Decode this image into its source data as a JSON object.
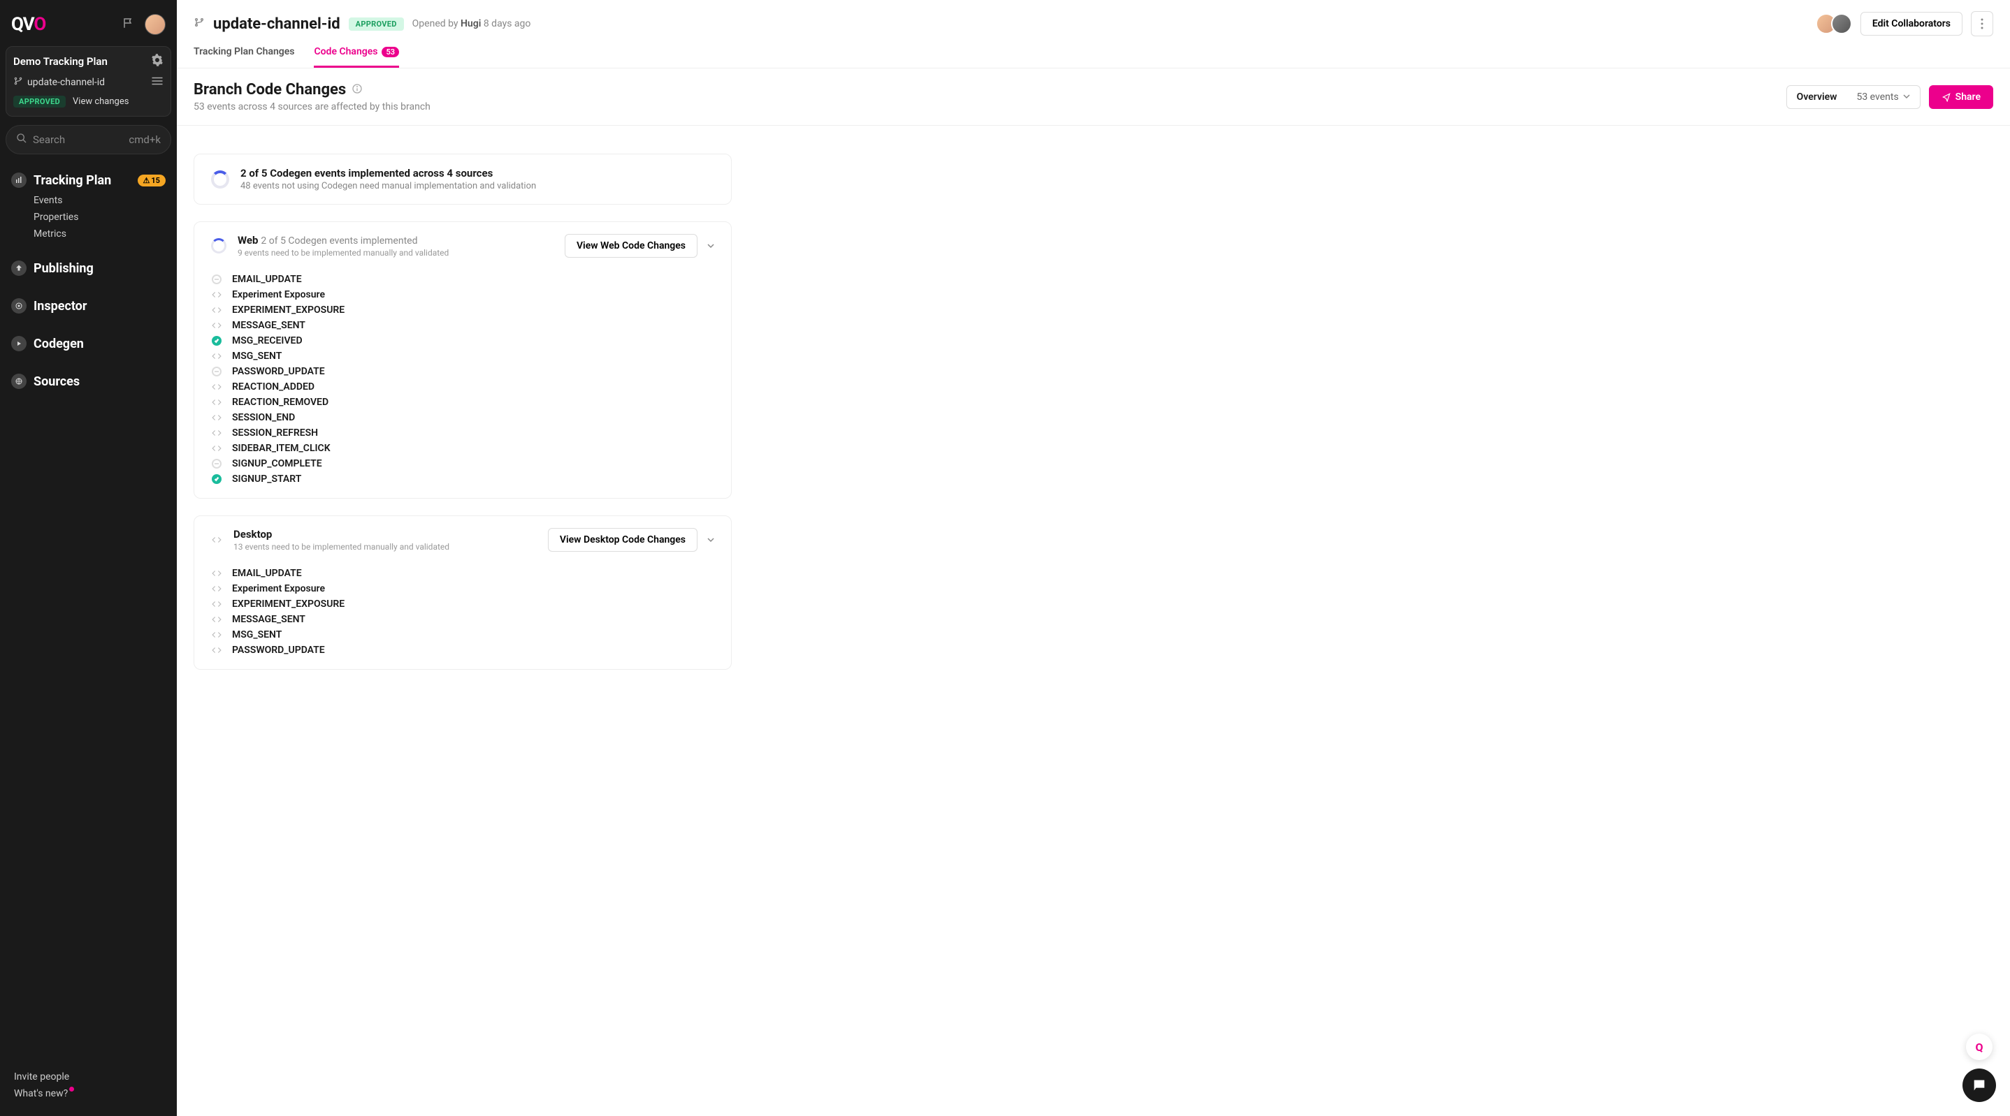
{
  "sidebar": {
    "plan_name": "Demo Tracking Plan",
    "branch_name": "update-channel-id",
    "status_label": "APPROVED",
    "view_changes_label": "View changes",
    "search_placeholder": "Search",
    "search_shortcut": "cmd+k",
    "nav": {
      "tracking_plan": "Tracking Plan",
      "tracking_plan_badge": "15",
      "events": "Events",
      "properties": "Properties",
      "metrics": "Metrics",
      "publishing": "Publishing",
      "inspector": "Inspector",
      "codegen": "Codegen",
      "sources": "Sources"
    },
    "invite_label": "Invite people",
    "whats_new_label": "What's new?"
  },
  "header": {
    "branch": "update-channel-id",
    "status": "APPROVED",
    "opened_by_prefix": "Opened by",
    "opened_by_name": "Hugi",
    "opened_by_time": "8 days ago",
    "edit_collab_label": "Edit Collaborators",
    "tabs": {
      "plan_changes": "Tracking Plan Changes",
      "code_changes": "Code Changes",
      "code_changes_count": "53"
    }
  },
  "subheader": {
    "title": "Branch Code Changes",
    "subtitle": "53 events across 4 sources are affected by this branch",
    "overview_label": "Overview",
    "events_label": "53 events",
    "share_label": "Share"
  },
  "summary": {
    "title": "2 of 5 Codegen events implemented across 4 sources",
    "subtitle": "48 events not using Codegen need manual implementation and validation"
  },
  "sources": [
    {
      "name": "Web",
      "meta": "2 of 5 Codegen events implemented",
      "sub": "9 events need to be implemented manually and validated",
      "button": "View Web Code Changes",
      "has_spinner": true,
      "events": [
        {
          "name": "EMAIL_UPDATE",
          "status": "dash"
        },
        {
          "name": "Experiment Exposure",
          "status": "code"
        },
        {
          "name": "EXPERIMENT_EXPOSURE",
          "status": "code"
        },
        {
          "name": "MESSAGE_SENT",
          "status": "code"
        },
        {
          "name": "MSG_RECEIVED",
          "status": "check"
        },
        {
          "name": "MSG_SENT",
          "status": "code"
        },
        {
          "name": "PASSWORD_UPDATE",
          "status": "dash"
        },
        {
          "name": "REACTION_ADDED",
          "status": "code"
        },
        {
          "name": "REACTION_REMOVED",
          "status": "code"
        },
        {
          "name": "SESSION_END",
          "status": "code"
        },
        {
          "name": "SESSION_REFRESH",
          "status": "code"
        },
        {
          "name": "SIDEBAR_ITEM_CLICK",
          "status": "code"
        },
        {
          "name": "SIGNUP_COMPLETE",
          "status": "dash"
        },
        {
          "name": "SIGNUP_START",
          "status": "check"
        }
      ]
    },
    {
      "name": "Desktop",
      "meta": "",
      "sub": "13 events need to be implemented manually and validated",
      "button": "View Desktop Code Changes",
      "has_spinner": false,
      "events": [
        {
          "name": "EMAIL_UPDATE",
          "status": "code"
        },
        {
          "name": "Experiment Exposure",
          "status": "code"
        },
        {
          "name": "EXPERIMENT_EXPOSURE",
          "status": "code"
        },
        {
          "name": "MESSAGE_SENT",
          "status": "code"
        },
        {
          "name": "MSG_SENT",
          "status": "code"
        },
        {
          "name": "PASSWORD_UPDATE",
          "status": "code"
        }
      ]
    }
  ]
}
